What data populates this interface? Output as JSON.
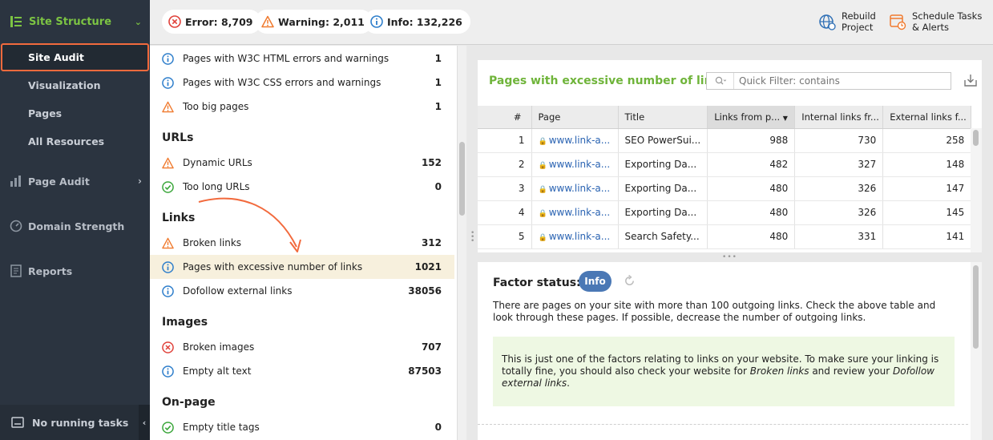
{
  "sidebar": {
    "section": "Site Structure",
    "subitems": [
      "Site Audit",
      "Visualization",
      "Pages",
      "All Resources"
    ],
    "groups": [
      "Page Audit",
      "Domain Strength",
      "Reports"
    ],
    "footer": "No running tasks"
  },
  "topbar": {
    "error": "Error: 8,709",
    "warning": "Warning: 2,011",
    "info": "Info: 132,226",
    "rebuild_l1": "Rebuild",
    "rebuild_l2": "Project",
    "schedule_l1": "Schedule Tasks",
    "schedule_l2": "& Alerts"
  },
  "list": {
    "rows": [
      {
        "icon": "info",
        "label": "Pages with W3C HTML errors and warnings",
        "count": "1"
      },
      {
        "icon": "info",
        "label": "Pages with W3C CSS errors and warnings",
        "count": "1"
      },
      {
        "icon": "warning",
        "label": "Too big pages",
        "count": "1"
      },
      {
        "icon": "warning",
        "label": "Dynamic URLs",
        "count": "152"
      },
      {
        "icon": "ok",
        "label": "Too long URLs",
        "count": "0"
      },
      {
        "icon": "warning",
        "label": "Broken links",
        "count": "312"
      },
      {
        "icon": "info",
        "label": "Pages with excessive number of links",
        "count": "1021"
      },
      {
        "icon": "info",
        "label": "Dofollow external links",
        "count": "38056"
      },
      {
        "icon": "error",
        "label": "Broken images",
        "count": "707"
      },
      {
        "icon": "info",
        "label": "Empty alt text",
        "count": "87503"
      },
      {
        "icon": "ok",
        "label": "Empty title tags",
        "count": "0"
      }
    ],
    "sections": [
      "URLs",
      "Links",
      "Images",
      "On-page"
    ]
  },
  "panel": {
    "title": "Pages with excessive number of links",
    "filter_placeholder": "Quick Filter: contains",
    "columns": [
      "#",
      "Page",
      "Title",
      "Links from p...",
      "Internal links fr...",
      "External links f..."
    ],
    "rows": [
      {
        "n": "1",
        "page": "www.link-a...",
        "title": "SEO PowerSui...",
        "links": "988",
        "internal": "730",
        "external": "258"
      },
      {
        "n": "2",
        "page": "www.link-a...",
        "title": "Exporting Da...",
        "links": "482",
        "internal": "327",
        "external": "148"
      },
      {
        "n": "3",
        "page": "www.link-a...",
        "title": "Exporting Da...",
        "links": "480",
        "internal": "326",
        "external": "147"
      },
      {
        "n": "4",
        "page": "www.link-a...",
        "title": "Exporting Da...",
        "links": "480",
        "internal": "326",
        "external": "145"
      },
      {
        "n": "5",
        "page": "www.link-a...",
        "title": "Search Safety...",
        "links": "480",
        "internal": "331",
        "external": "141"
      }
    ]
  },
  "factor": {
    "label": "Factor status:",
    "badge": "Info",
    "description": "There are pages on your site with more than 100 outgoing links. Check the above table and look through these pages. If possible, decrease the number of outgoing links.",
    "note_a": "This is just one of the factors relating to links on your website. To make sure your linking is totally fine, you should also check your website for ",
    "note_link1": "Broken links",
    "note_b": " and review your ",
    "note_link2": "Dofollow external links",
    "note_c": "."
  },
  "colors": {
    "accent_green": "#6fb43a",
    "error": "#e0413a",
    "warning": "#f07a2e",
    "info": "#2e7ecb",
    "ok": "#3aa63a",
    "active_border": "#f26a3d"
  }
}
